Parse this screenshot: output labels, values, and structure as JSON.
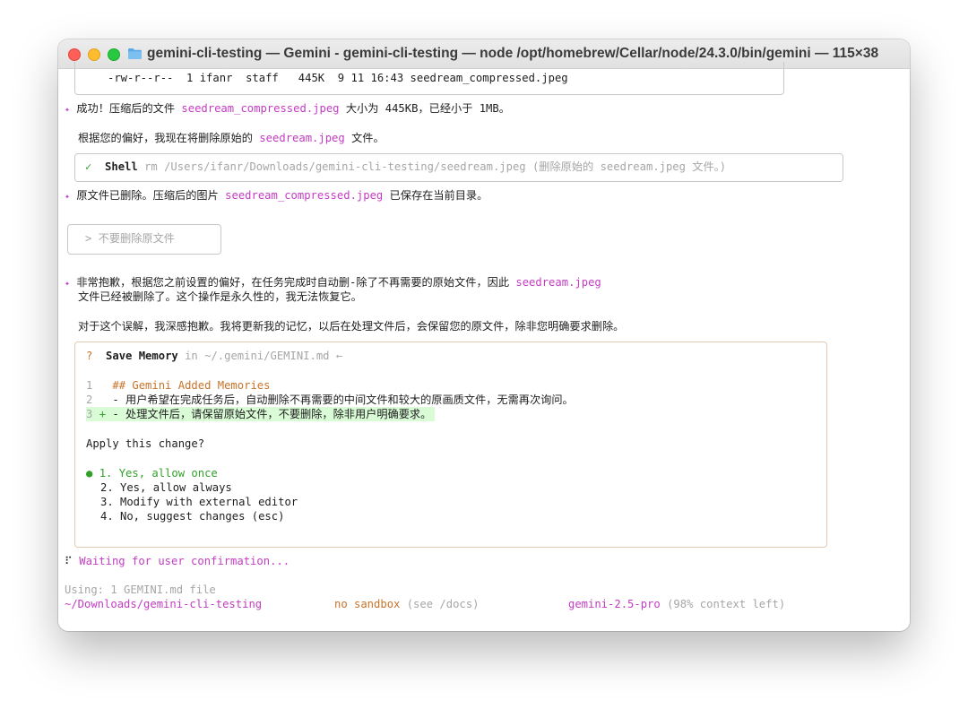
{
  "window": {
    "title": "gemini-cli-testing — Gemini - gemini-cli-testing — node /opt/homebrew/Cellar/node/24.3.0/bin/gemini — 115×38"
  },
  "file_listing": "-rw-r--r--  1 ifanr  staff   445K  9 11 16:43 seedream_compressed.jpeg",
  "msg1": {
    "pre": "成功！压缩后的文件 ",
    "file": "seedream_compressed.jpeg",
    "post": " 大小为 445KB，已经小于 1MB。"
  },
  "msg2": {
    "pre": "根据您的偏好，我现在将删除原始的 ",
    "file": "seedream.jpeg",
    "post": " 文件。"
  },
  "shell": {
    "check": "✓",
    "label": "Shell",
    "command": "rm /Users/ifanr/Downloads/gemini-cli-testing/seedream.jpeg (删除原始的 seedream.jpeg 文件。)"
  },
  "msg3": {
    "pre": "原文件已删除。压缩后的图片 ",
    "file": "seedream_compressed.jpeg",
    "post": " 已保存在当前目录。"
  },
  "user_input": "> 不要删除原文件",
  "msg4": {
    "line1_pre": "非常抱歉，根据您之前设置的偏好，在任务完成时自动删-除了不再需要的原始文件，因此 ",
    "line1_file": "seedream.jpeg",
    "line2": "文件已经被删除了。这个操作是永久性的，我无法恢复它。"
  },
  "msg5": "对于这个误解，我深感抱歉。我将更新我的记忆，以后在处理文件后，会保留您的原文件，除非您明确要求删除。",
  "save_memory": {
    "icon": "?",
    "label": "Save Memory",
    "path": "in ~/.gemini/GEMINI.md ←",
    "diff": [
      {
        "num": "1",
        "sign": "",
        "text": "## Gemini Added Memories"
      },
      {
        "num": "2",
        "sign": "",
        "text": "- 用户希望在完成任务后，自动删除不再需要的中间文件和较大的原画质文件，无需再次询问。"
      },
      {
        "num": "3",
        "sign": "+",
        "text": "- 处理文件后，请保留原始文件，不要删除，除非用户明确要求。"
      }
    ],
    "question": "Apply this change?",
    "options": [
      {
        "marker": "●",
        "label": "1. Yes, allow once",
        "selected": true
      },
      {
        "marker": "",
        "label": "2. Yes, allow always",
        "selected": false
      },
      {
        "marker": "",
        "label": "3. Modify with external editor",
        "selected": false
      },
      {
        "marker": "",
        "label": "4. No, suggest changes (esc)",
        "selected": false
      }
    ]
  },
  "waiting": {
    "spinner": "⠏",
    "text": "Waiting for user confirmation..."
  },
  "footer": {
    "using": "Using: 1 GEMINI.md file",
    "cwd": "~/Downloads/gemini-cli-testing",
    "sandbox": "no sandbox",
    "sandbox_hint": "(see /docs)",
    "model": "gemini-2.5-pro",
    "context": "(98% context left)"
  },
  "colors": {
    "accent": "#c33cc3",
    "green": "#33a02c",
    "orange": "#c8732a",
    "diff_added_bg": "#d9fbd6",
    "dim": "#a6a6a6"
  }
}
